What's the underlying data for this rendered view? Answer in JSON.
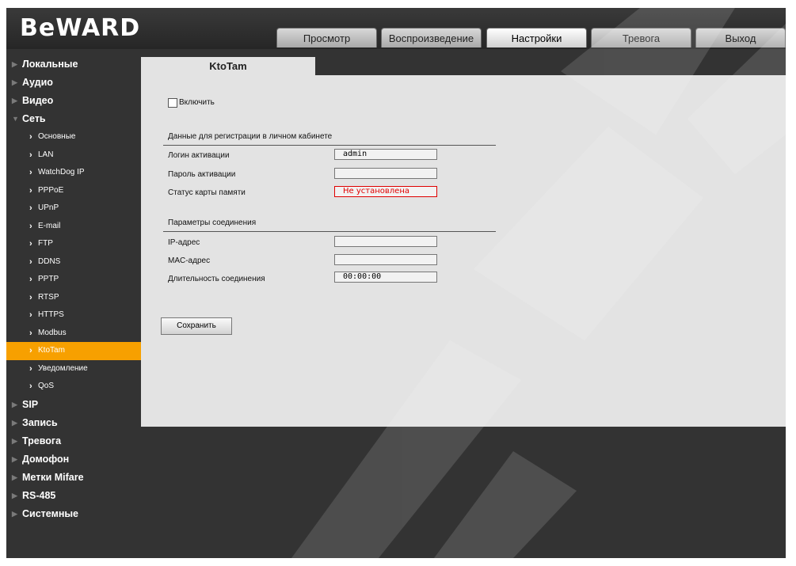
{
  "brand": {
    "logo": "BeWARD"
  },
  "tabs": [
    {
      "label": "Просмотр"
    },
    {
      "label": "Воспроизведение"
    },
    {
      "label": "Настройки"
    },
    {
      "label": "Тревога"
    },
    {
      "label": "Выход"
    }
  ],
  "active_tab": "Настройки",
  "sidebar": {
    "top": [
      {
        "label": "Локальные"
      },
      {
        "label": "Аудио"
      },
      {
        "label": "Видео"
      },
      {
        "label": "Сеть"
      }
    ],
    "network_items": [
      {
        "label": "Основные"
      },
      {
        "label": "LAN"
      },
      {
        "label": "WatchDog IP"
      },
      {
        "label": "PPPoE"
      },
      {
        "label": "UPnP"
      },
      {
        "label": "E-mail"
      },
      {
        "label": "FTP"
      },
      {
        "label": "DDNS"
      },
      {
        "label": "PPTP"
      },
      {
        "label": "RTSP"
      },
      {
        "label": "HTTPS"
      },
      {
        "label": "Modbus"
      },
      {
        "label": "KtoTam"
      },
      {
        "label": "Уведомление"
      },
      {
        "label": "QoS"
      }
    ],
    "bottom": [
      {
        "label": "SIP"
      },
      {
        "label": "Запись"
      },
      {
        "label": "Тревога"
      },
      {
        "label": "Домофон"
      },
      {
        "label": "Метки Mifare"
      },
      {
        "label": "RS-485"
      },
      {
        "label": "Системные"
      }
    ]
  },
  "panel": {
    "title": "KtoTam",
    "enable_label": "Включить",
    "enable_checked": false,
    "section1_title": "Данные для регистрации в личном кабинете",
    "login_label": "Логин активации",
    "login_value": "admin",
    "password_label": "Пароль активации",
    "password_value": "",
    "sd_label": "Статус карты памяти",
    "sd_value": "Не установлена",
    "section2_title": "Параметры соединения",
    "ip_label": "IP-адрес",
    "ip_value": "",
    "mac_label": "MAC-адрес",
    "mac_value": "",
    "duration_label": "Длительность соединения",
    "duration_value": "00:00:00",
    "save_label": "Сохранить"
  },
  "colors": {
    "active_item": "#f7a000",
    "panel_bg": "#e3e3e3",
    "frame_bg": "#333333",
    "status_red": "#e00000"
  }
}
